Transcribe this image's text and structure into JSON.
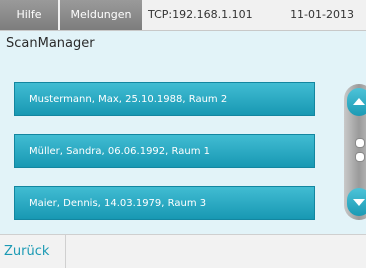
{
  "topbar": {
    "tab_help": "Hilfe",
    "tab_messages": "Meldungen",
    "connection": "TCP:192.168.1.101",
    "date": "11-01-2013"
  },
  "title": "ScanManager",
  "patients": [
    {
      "label": "Mustermann, Max, 25.10.1988, Raum 2"
    },
    {
      "label": "Müller, Sandra, 06.06.1992, Raum 1"
    },
    {
      "label": "Maier, Dennis, 14.03.1979, Raum 3"
    }
  ],
  "scroll": {
    "up_icon": "chevron-up-icon",
    "down_icon": "chevron-down-icon"
  },
  "bottombar": {
    "back_label": "Zurück"
  },
  "colors": {
    "accent": "#1b9ab4",
    "background": "#e2f3f8",
    "tab": "#8a8a8a"
  }
}
